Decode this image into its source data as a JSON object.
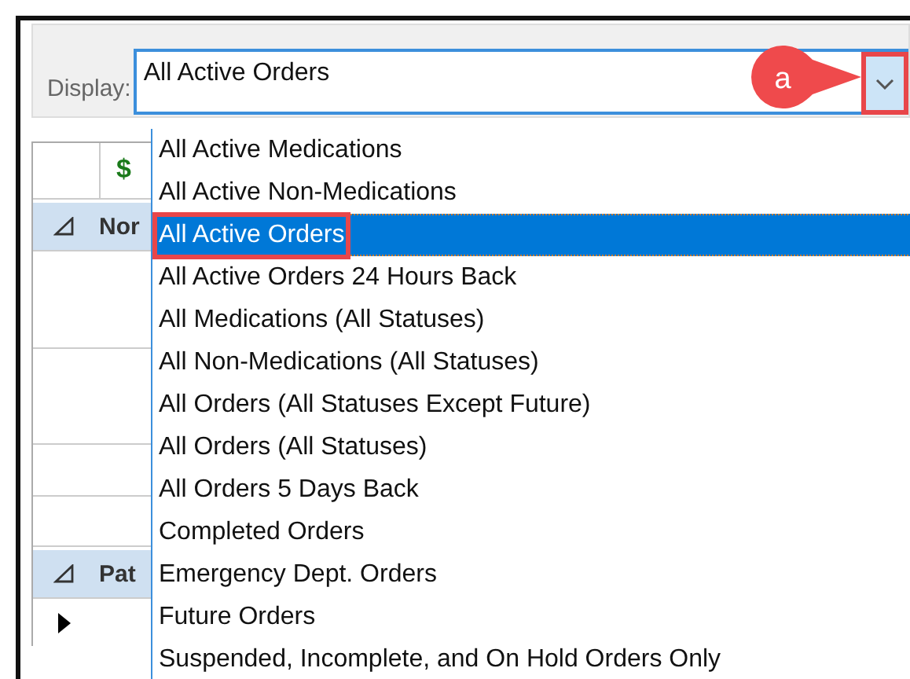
{
  "toolbar": {
    "display_label": "Display:",
    "combo": {
      "value": "All Active Orders",
      "expanded": true,
      "highlighted": true
    }
  },
  "callout": {
    "label": "a"
  },
  "grid": {
    "header": {
      "column_2": "$"
    },
    "rows": [
      {
        "kind": "group",
        "label": "Nor",
        "current": false
      },
      {
        "kind": "row",
        "current": false
      },
      {
        "kind": "row",
        "current": false
      },
      {
        "kind": "row",
        "current": false
      },
      {
        "kind": "row",
        "current": false
      },
      {
        "kind": "group",
        "label": "Pat",
        "current": false
      },
      {
        "kind": "row",
        "current": true
      }
    ]
  },
  "options": [
    {
      "label": "All Active Medications",
      "selected": false,
      "highlighted": false
    },
    {
      "label": "All Active Non-Medications",
      "selected": false,
      "highlighted": false
    },
    {
      "label": "All Active Orders",
      "selected": true,
      "highlighted": true
    },
    {
      "label": "All Active Orders 24 Hours Back",
      "selected": false,
      "highlighted": false
    },
    {
      "label": "All Medications (All Statuses)",
      "selected": false,
      "highlighted": false
    },
    {
      "label": "All Non-Medications (All Statuses)",
      "selected": false,
      "highlighted": false
    },
    {
      "label": "All Orders (All Statuses Except Future)",
      "selected": false,
      "highlighted": false
    },
    {
      "label": "All Orders (All Statuses)",
      "selected": false,
      "highlighted": false
    },
    {
      "label": "All Orders 5 Days Back",
      "selected": false,
      "highlighted": false
    },
    {
      "label": "Completed Orders",
      "selected": false,
      "highlighted": false
    },
    {
      "label": "Emergency Dept. Orders",
      "selected": false,
      "highlighted": false
    },
    {
      "label": "Future Orders",
      "selected": false,
      "highlighted": false
    },
    {
      "label": "Suspended, Incomplete, and On Hold Orders Only",
      "selected": false,
      "highlighted": false
    }
  ]
}
